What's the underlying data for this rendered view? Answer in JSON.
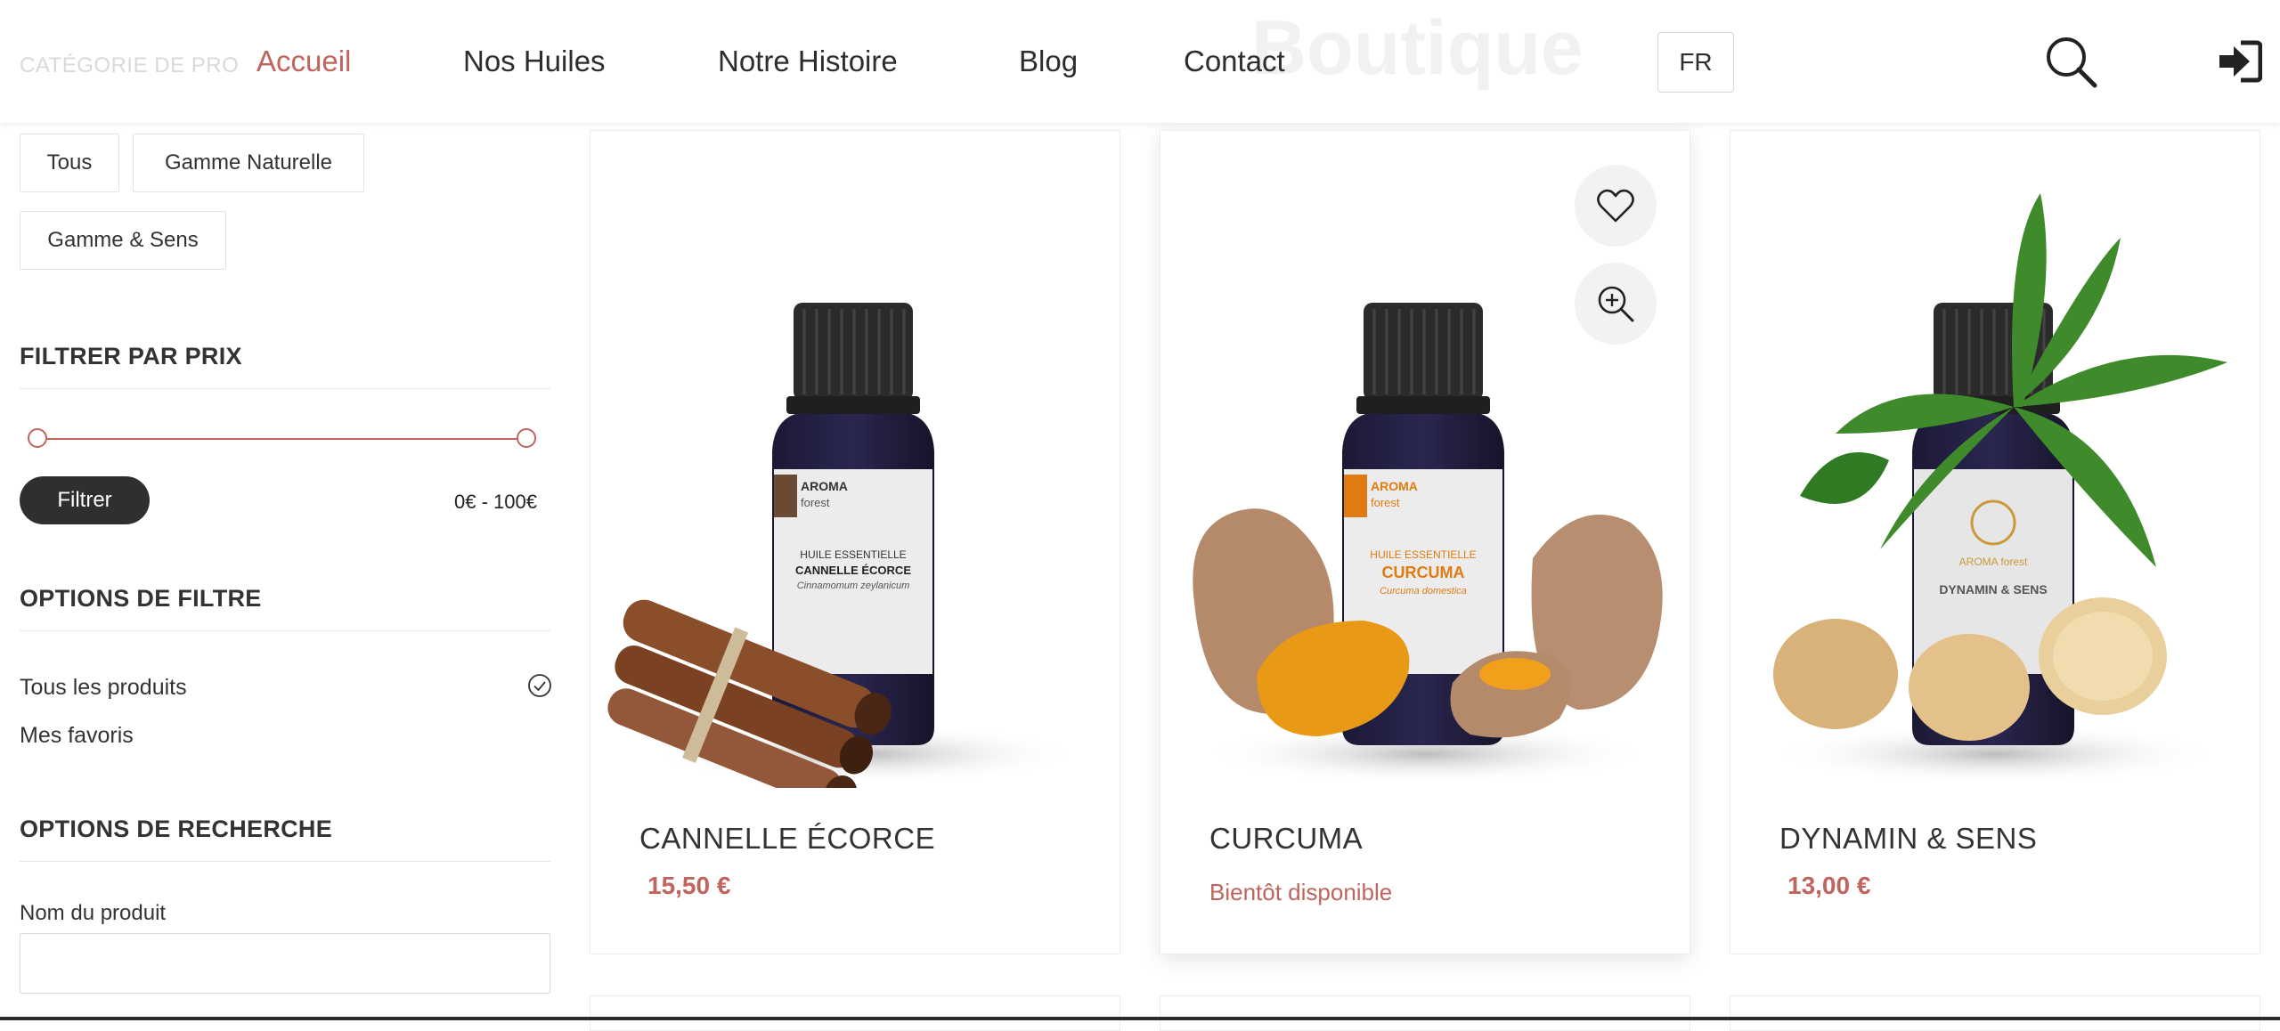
{
  "header": {
    "bg_title": "Boutique",
    "ghost_category": "CATÉGORIE DE PRO",
    "nav": [
      "Accueil",
      "Nos Huiles",
      "Notre Histoire",
      "Blog",
      "Contact"
    ],
    "active_nav": "Accueil",
    "lang": "FR",
    "icons": [
      "search-icon",
      "login-icon"
    ]
  },
  "sidebar": {
    "categories": [
      "Tous",
      "Gamme Naturelle",
      "Gamme & Sens"
    ],
    "price_heading": "FILTRER PAR PRIX",
    "price_min": 0,
    "price_max": 100,
    "filter_button": "Filtrer",
    "price_range": "0€ - 100€",
    "options_heading": "OPTIONS DE FILTRE",
    "options": [
      "Tous les produits",
      "Mes favoris"
    ],
    "selected_option": "Tous les produits",
    "search_heading": "OPTIONS DE RECHERCHE",
    "name_label": "Nom du produit",
    "name_value": ""
  },
  "products": [
    {
      "name": "CANNELLE ÉCORCE",
      "price": "15,50 €",
      "label_line1": "HUILE ESSENTIELLE",
      "label_line2": "CANNELLE ÉCORCE",
      "label_line3": "Cinnamomum zeylanicum",
      "accent": "#6b4a34"
    },
    {
      "name": "CURCUMA",
      "status": "Bientôt disponible",
      "label_line1": "HUILE ESSENTIELLE",
      "label_line2": "CURCUMA",
      "label_line3": "Curcuma domestica",
      "accent": "#e07b12"
    },
    {
      "name": "DYNAMIN & SENS",
      "price": "13,00 €",
      "label_line1": "AROMA forest",
      "label_line2": "DYNAMIN & SENS",
      "label_line3": "",
      "accent": "#c99a3a"
    }
  ],
  "brand": {
    "line1": "AROMA",
    "line2": "forest"
  },
  "colors": {
    "accent": "#c0645e",
    "dark": "#2f2f2f"
  }
}
